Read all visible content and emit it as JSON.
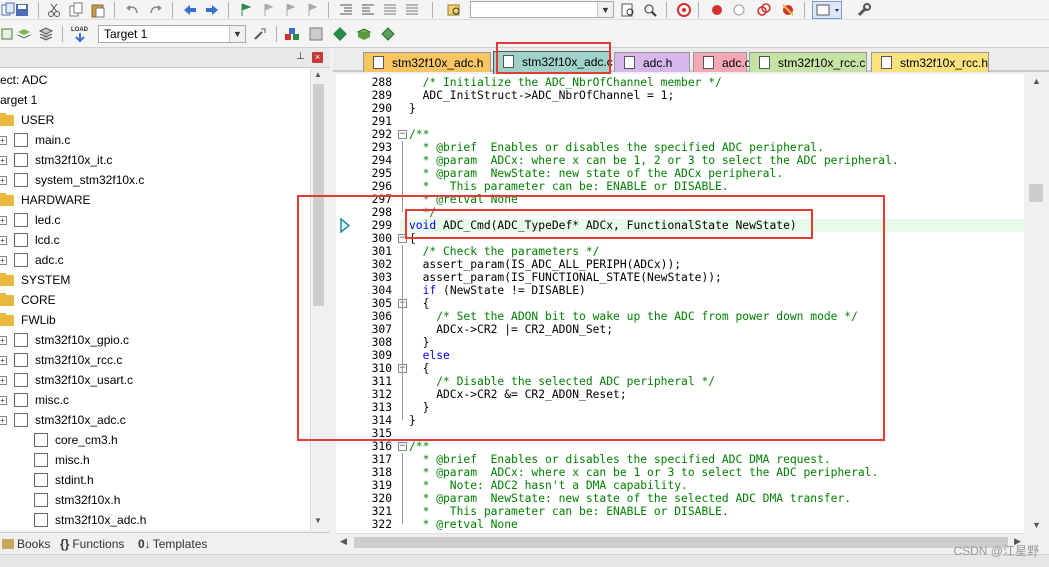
{
  "toolbar": {
    "target_select": "Target 1"
  },
  "project_panel": {
    "items": [
      {
        "label": "ect: ADC",
        "type": "root"
      },
      {
        "label": "arget 1",
        "type": "target"
      },
      {
        "label": "USER",
        "type": "folder"
      },
      {
        "label": "main.c",
        "type": "file"
      },
      {
        "label": "stm32f10x_it.c",
        "type": "file"
      },
      {
        "label": "system_stm32f10x.c",
        "type": "file"
      },
      {
        "label": "HARDWARE",
        "type": "folder"
      },
      {
        "label": "led.c",
        "type": "file"
      },
      {
        "label": "lcd.c",
        "type": "file"
      },
      {
        "label": "adc.c",
        "type": "file"
      },
      {
        "label": "SYSTEM",
        "type": "folder"
      },
      {
        "label": "CORE",
        "type": "folder"
      },
      {
        "label": "FWLib",
        "type": "folder"
      },
      {
        "label": "stm32f10x_gpio.c",
        "type": "file"
      },
      {
        "label": "stm32f10x_rcc.c",
        "type": "file"
      },
      {
        "label": "stm32f10x_usart.c",
        "type": "file"
      },
      {
        "label": "misc.c",
        "type": "file"
      },
      {
        "label": "stm32f10x_adc.c",
        "type": "file"
      },
      {
        "label": "core_cm3.h",
        "type": "file"
      },
      {
        "label": "misc.h",
        "type": "file"
      },
      {
        "label": "stdint.h",
        "type": "file"
      },
      {
        "label": "stm32f10x.h",
        "type": "file"
      },
      {
        "label": "stm32f10x_adc.h",
        "type": "file"
      }
    ],
    "tabs": [
      "Books",
      "Functions",
      "Templates"
    ]
  },
  "file_tabs": [
    {
      "label": "stm32f10x_adc.h",
      "color": "#f7c663"
    },
    {
      "label": "stm32f10x_adc.c",
      "color": "#9fd2c9",
      "active": true
    },
    {
      "label": "adc.h",
      "color": "#d7b8ee"
    },
    {
      "label": "adc.c",
      "color": "#f4a9b5"
    },
    {
      "label": "stm32f10x_rcc.c",
      "color": "#c5e3a4"
    },
    {
      "label": "stm32f10x_rcc.h",
      "color": "#fbe27d"
    }
  ],
  "editor": {
    "lines": [
      {
        "n": "288",
        "segs": [
          {
            "c": "cm",
            "t": "  /* Initialize the ADC_NbrOfChannel member */"
          }
        ]
      },
      {
        "n": "289",
        "segs": [
          {
            "c": "tx",
            "t": "  ADC_InitStruct->ADC_NbrOfChannel = 1;"
          }
        ]
      },
      {
        "n": "290",
        "segs": [
          {
            "c": "tx",
            "t": "}"
          }
        ]
      },
      {
        "n": "291",
        "segs": [
          {
            "c": "tx",
            "t": ""
          }
        ]
      },
      {
        "n": "292",
        "segs": [
          {
            "c": "cm",
            "t": "/**"
          }
        ]
      },
      {
        "n": "293",
        "segs": [
          {
            "c": "cm",
            "t": "  * @brief  Enables or disables the specified ADC peripheral."
          }
        ]
      },
      {
        "n": "294",
        "segs": [
          {
            "c": "cm",
            "t": "  * @param  ADCx: where x can be 1, 2 or 3 to select the ADC peripheral."
          }
        ]
      },
      {
        "n": "295",
        "segs": [
          {
            "c": "cm",
            "t": "  * @param  NewState: new state of the ADCx peripheral."
          }
        ]
      },
      {
        "n": "296",
        "segs": [
          {
            "c": "cm",
            "t": "  *   This parameter can be: ENABLE or DISABLE."
          }
        ]
      },
      {
        "n": "297",
        "segs": [
          {
            "c": "cm",
            "t": "  * @retval None"
          }
        ]
      },
      {
        "n": "298",
        "segs": [
          {
            "c": "cm",
            "t": "  */"
          }
        ]
      },
      {
        "n": "299",
        "segs": [
          {
            "c": "kw",
            "t": "void"
          },
          {
            "c": "tx",
            "t": " ADC_Cmd(ADC_TypeDef* ADCx, FunctionalState NewState)"
          }
        ]
      },
      {
        "n": "300",
        "segs": [
          {
            "c": "tx",
            "t": "{"
          }
        ]
      },
      {
        "n": "301",
        "segs": [
          {
            "c": "cm",
            "t": "  /* Check the parameters */"
          }
        ]
      },
      {
        "n": "302",
        "segs": [
          {
            "c": "tx",
            "t": "  assert_param(IS_ADC_ALL_PERIPH(ADCx));"
          }
        ]
      },
      {
        "n": "303",
        "segs": [
          {
            "c": "tx",
            "t": "  assert_param(IS_FUNCTIONAL_STATE(NewState));"
          }
        ]
      },
      {
        "n": "304",
        "segs": [
          {
            "c": "kw",
            "t": "  if"
          },
          {
            "c": "tx",
            "t": " (NewState != DISABLE)"
          }
        ]
      },
      {
        "n": "305",
        "segs": [
          {
            "c": "tx",
            "t": "  {"
          }
        ]
      },
      {
        "n": "306",
        "segs": [
          {
            "c": "cm",
            "t": "    /* Set the ADON bit to wake up the ADC from power down mode */"
          }
        ]
      },
      {
        "n": "307",
        "segs": [
          {
            "c": "tx",
            "t": "    ADCx->CR2 |= CR2_ADON_Set;"
          }
        ]
      },
      {
        "n": "308",
        "segs": [
          {
            "c": "tx",
            "t": "  }"
          }
        ]
      },
      {
        "n": "309",
        "segs": [
          {
            "c": "kw",
            "t": "  else"
          }
        ]
      },
      {
        "n": "310",
        "segs": [
          {
            "c": "tx",
            "t": "  {"
          }
        ]
      },
      {
        "n": "311",
        "segs": [
          {
            "c": "cm",
            "t": "    /* Disable the selected ADC peripheral */"
          }
        ]
      },
      {
        "n": "312",
        "segs": [
          {
            "c": "tx",
            "t": "    ADCx->CR2 &= CR2_ADON_Reset;"
          }
        ]
      },
      {
        "n": "313",
        "segs": [
          {
            "c": "tx",
            "t": "  }"
          }
        ]
      },
      {
        "n": "314",
        "segs": [
          {
            "c": "tx",
            "t": "}"
          }
        ]
      },
      {
        "n": "315",
        "segs": [
          {
            "c": "tx",
            "t": ""
          }
        ]
      },
      {
        "n": "316",
        "segs": [
          {
            "c": "cm",
            "t": "/**"
          }
        ]
      },
      {
        "n": "317",
        "segs": [
          {
            "c": "cm",
            "t": "  * @brief  Enables or disables the specified ADC DMA request."
          }
        ]
      },
      {
        "n": "318",
        "segs": [
          {
            "c": "cm",
            "t": "  * @param  ADCx: where x can be 1 or 3 to select the ADC peripheral."
          }
        ]
      },
      {
        "n": "319",
        "segs": [
          {
            "c": "cm",
            "t": "  *   Note: ADC2 hasn't a DMA capability."
          }
        ]
      },
      {
        "n": "320",
        "segs": [
          {
            "c": "cm",
            "t": "  * @param  NewState: new state of the selected ADC DMA transfer."
          }
        ]
      },
      {
        "n": "321",
        "segs": [
          {
            "c": "cm",
            "t": "  *   This parameter can be: ENABLE or DISABLE."
          }
        ]
      },
      {
        "n": "322",
        "segs": [
          {
            "c": "cm",
            "t": "  * @retval None"
          }
        ]
      }
    ]
  },
  "watermark": "CSDN @江星野"
}
